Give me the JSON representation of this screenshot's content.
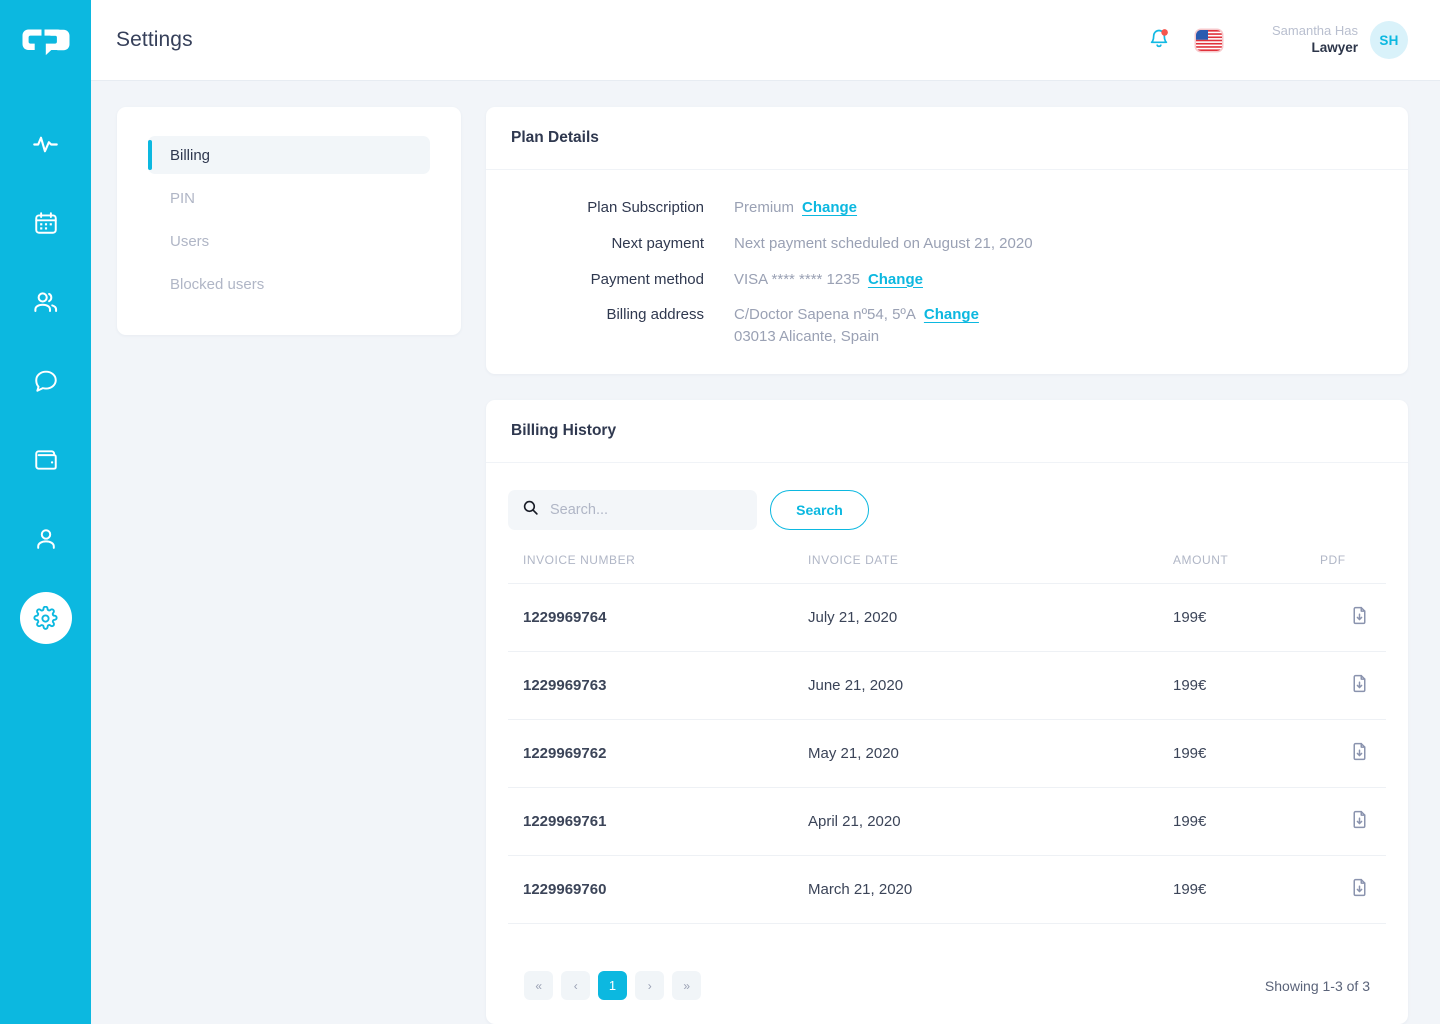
{
  "header": {
    "title": "Settings",
    "notification_icon": "bell-icon",
    "has_notification_dot": true,
    "language_icon": "us-flag-icon",
    "user_name": "Samantha Has",
    "user_role": "Lawyer",
    "avatar_initials": "SH"
  },
  "rail": {
    "logo": "cp-logo",
    "items": [
      {
        "name": "activity-icon",
        "active": false
      },
      {
        "name": "calendar-icon",
        "active": false
      },
      {
        "name": "users-icon",
        "active": false
      },
      {
        "name": "chat-icon",
        "active": false
      },
      {
        "name": "wallet-icon",
        "active": false
      },
      {
        "name": "profile-icon",
        "active": false
      },
      {
        "name": "settings-gear-icon",
        "active": true
      }
    ]
  },
  "settings_nav": {
    "items": [
      {
        "label": "Billing",
        "active": true
      },
      {
        "label": "PIN",
        "active": false
      },
      {
        "label": "Users",
        "active": false
      },
      {
        "label": "Blocked users",
        "active": false
      }
    ]
  },
  "plan_details": {
    "title": "Plan Details",
    "change_label": "Change",
    "rows": [
      {
        "label": "Plan Subscription",
        "value": "Premium",
        "has_change": true
      },
      {
        "label": "Next payment",
        "value": "Next payment scheduled on August 21, 2020",
        "has_change": false
      },
      {
        "label": "Payment method",
        "value": "VISA **** **** 1235",
        "has_change": true
      },
      {
        "label": "Billing address",
        "value": "C/Doctor Sapena nº54, 5ºA",
        "value_line2": "03013 Alicante, Spain",
        "has_change": true
      }
    ]
  },
  "billing_history": {
    "title": "Billing History",
    "search": {
      "placeholder": "Search...",
      "value": "",
      "icon": "search-icon",
      "button_label": "Search"
    },
    "columns": [
      "INVOICE NUMBER",
      "INVOICE DATE",
      "AMOUNT",
      "PDF"
    ],
    "rows": [
      {
        "number": "1229969764",
        "date": "July 21, 2020",
        "amount": "199€",
        "pdf_icon": "file-download-icon"
      },
      {
        "number": "1229969763",
        "date": "June 21, 2020",
        "amount": "199€",
        "pdf_icon": "file-download-icon"
      },
      {
        "number": "1229969762",
        "date": "May 21, 2020",
        "amount": "199€",
        "pdf_icon": "file-download-icon"
      },
      {
        "number": "1229969761",
        "date": "April 21, 2020",
        "amount": "199€",
        "pdf_icon": "file-download-icon"
      },
      {
        "number": "1229969760",
        "date": "March 21, 2020",
        "amount": "199€",
        "pdf_icon": "file-download-icon"
      }
    ],
    "pagination": {
      "first": "«",
      "prev": "‹",
      "current": "1",
      "next": "›",
      "last": "»",
      "showing": "Showing 1-3 of 3"
    }
  },
  "colors": {
    "accent": "#0CB8E0",
    "page_bg": "#F2F5F9",
    "card_bg": "#FFFFFF",
    "text_dark": "#2F384F",
    "text_muted": "#B0B6C6",
    "notification_dot": "#F4564E"
  }
}
